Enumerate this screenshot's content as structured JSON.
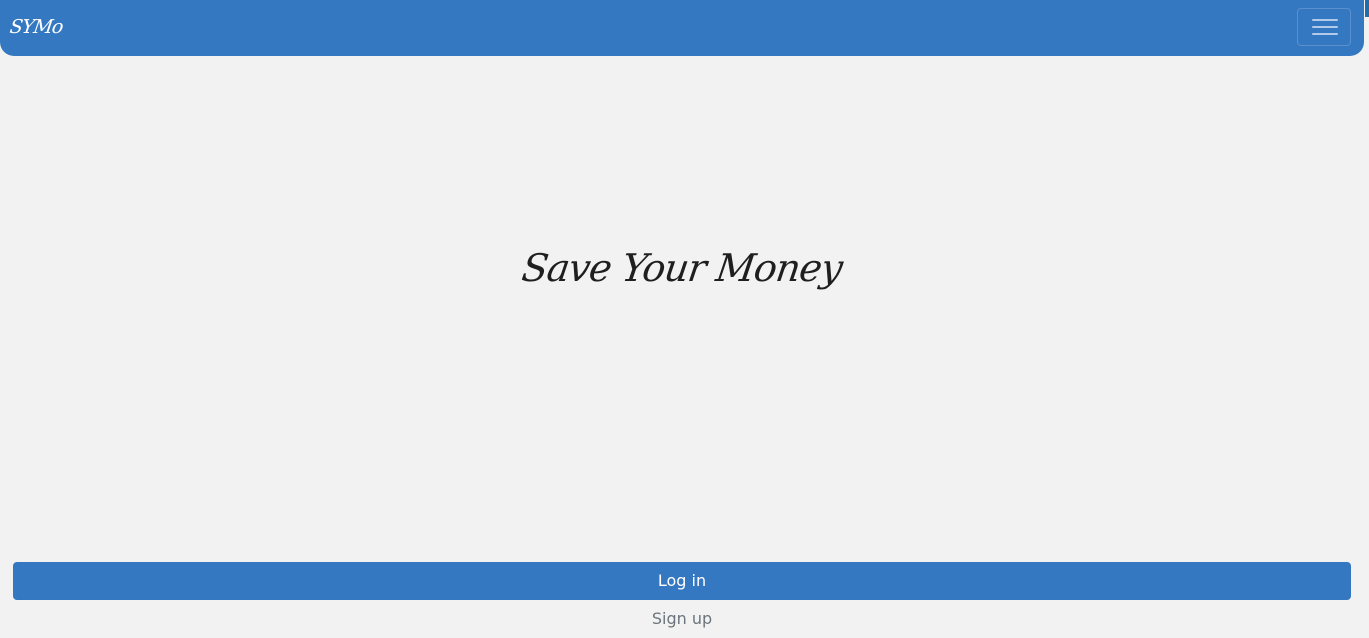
{
  "navbar": {
    "brand": "SYMo",
    "toggle_icon": "hamburger-menu-icon"
  },
  "hero": {
    "title": "Save Your Money"
  },
  "actions": {
    "login_label": "Log in",
    "signup_label": "Sign up"
  },
  "colors": {
    "primary": "#3578c2",
    "background": "#f1f2f1",
    "muted_text": "#6c757d"
  }
}
